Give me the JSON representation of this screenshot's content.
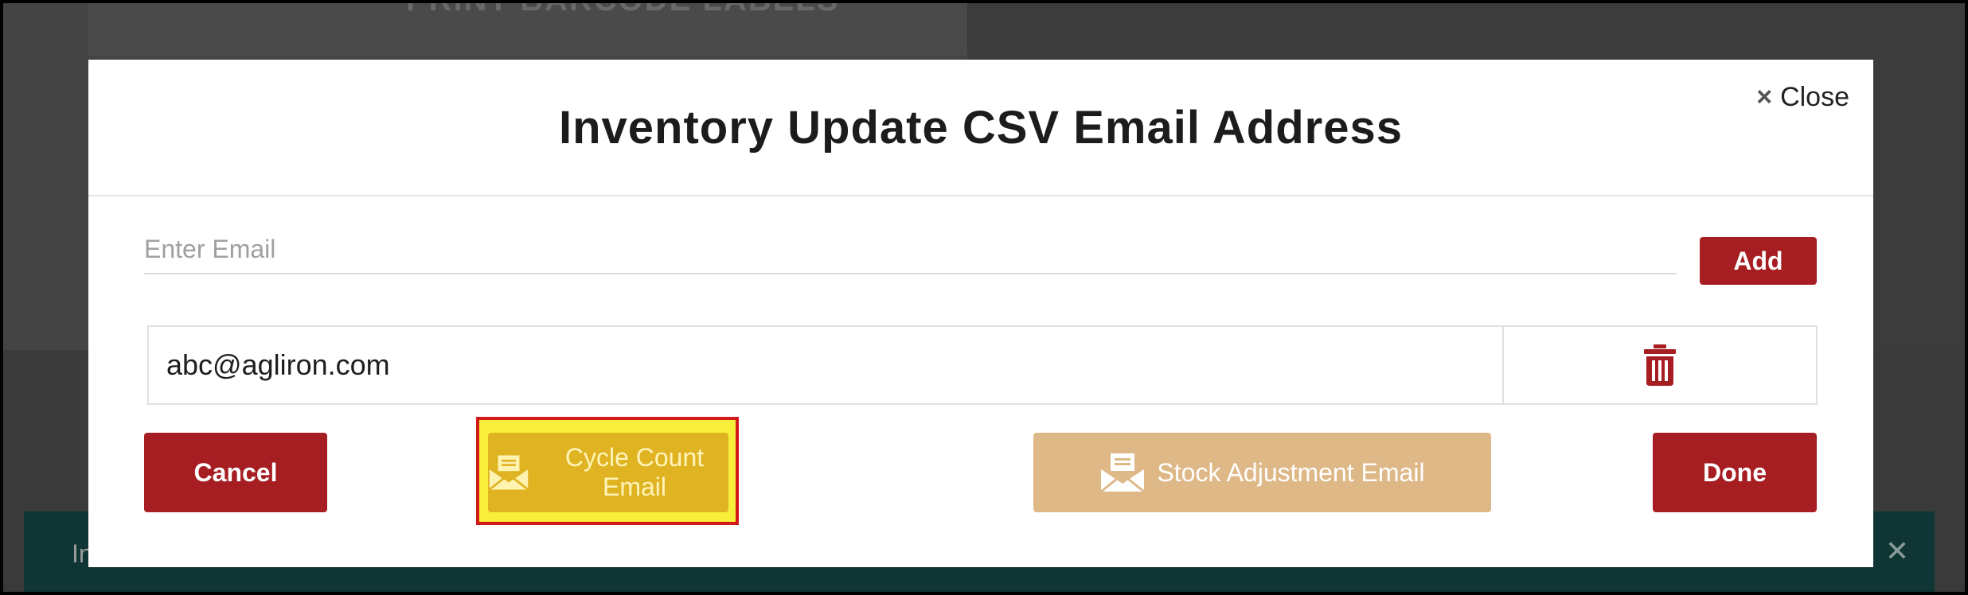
{
  "background": {
    "heading": "PRINT BARCODE LABELS",
    "banner_text": "In",
    "banner_close": "✕"
  },
  "modal": {
    "title": "Inventory Update CSV Email Address",
    "close_label": "Close",
    "close_icon": "×",
    "email_input": {
      "placeholder": "Enter Email",
      "value": ""
    },
    "add_label": "Add",
    "emails": [
      {
        "address": "abc@agliron.com",
        "action_icon": "trash-icon"
      }
    ],
    "buttons": {
      "cancel": "Cancel",
      "cycle_count": "Cycle Count Email",
      "stock_adjustment": "Stock Adjustment Email",
      "done": "Done"
    }
  },
  "colors": {
    "primary_red": "#a61e22",
    "cycle_gold": "#e0b323",
    "stock_tan": "#dfb887",
    "highlight_yellow": "#f7ef3a",
    "highlight_border": "#d21a1a"
  }
}
